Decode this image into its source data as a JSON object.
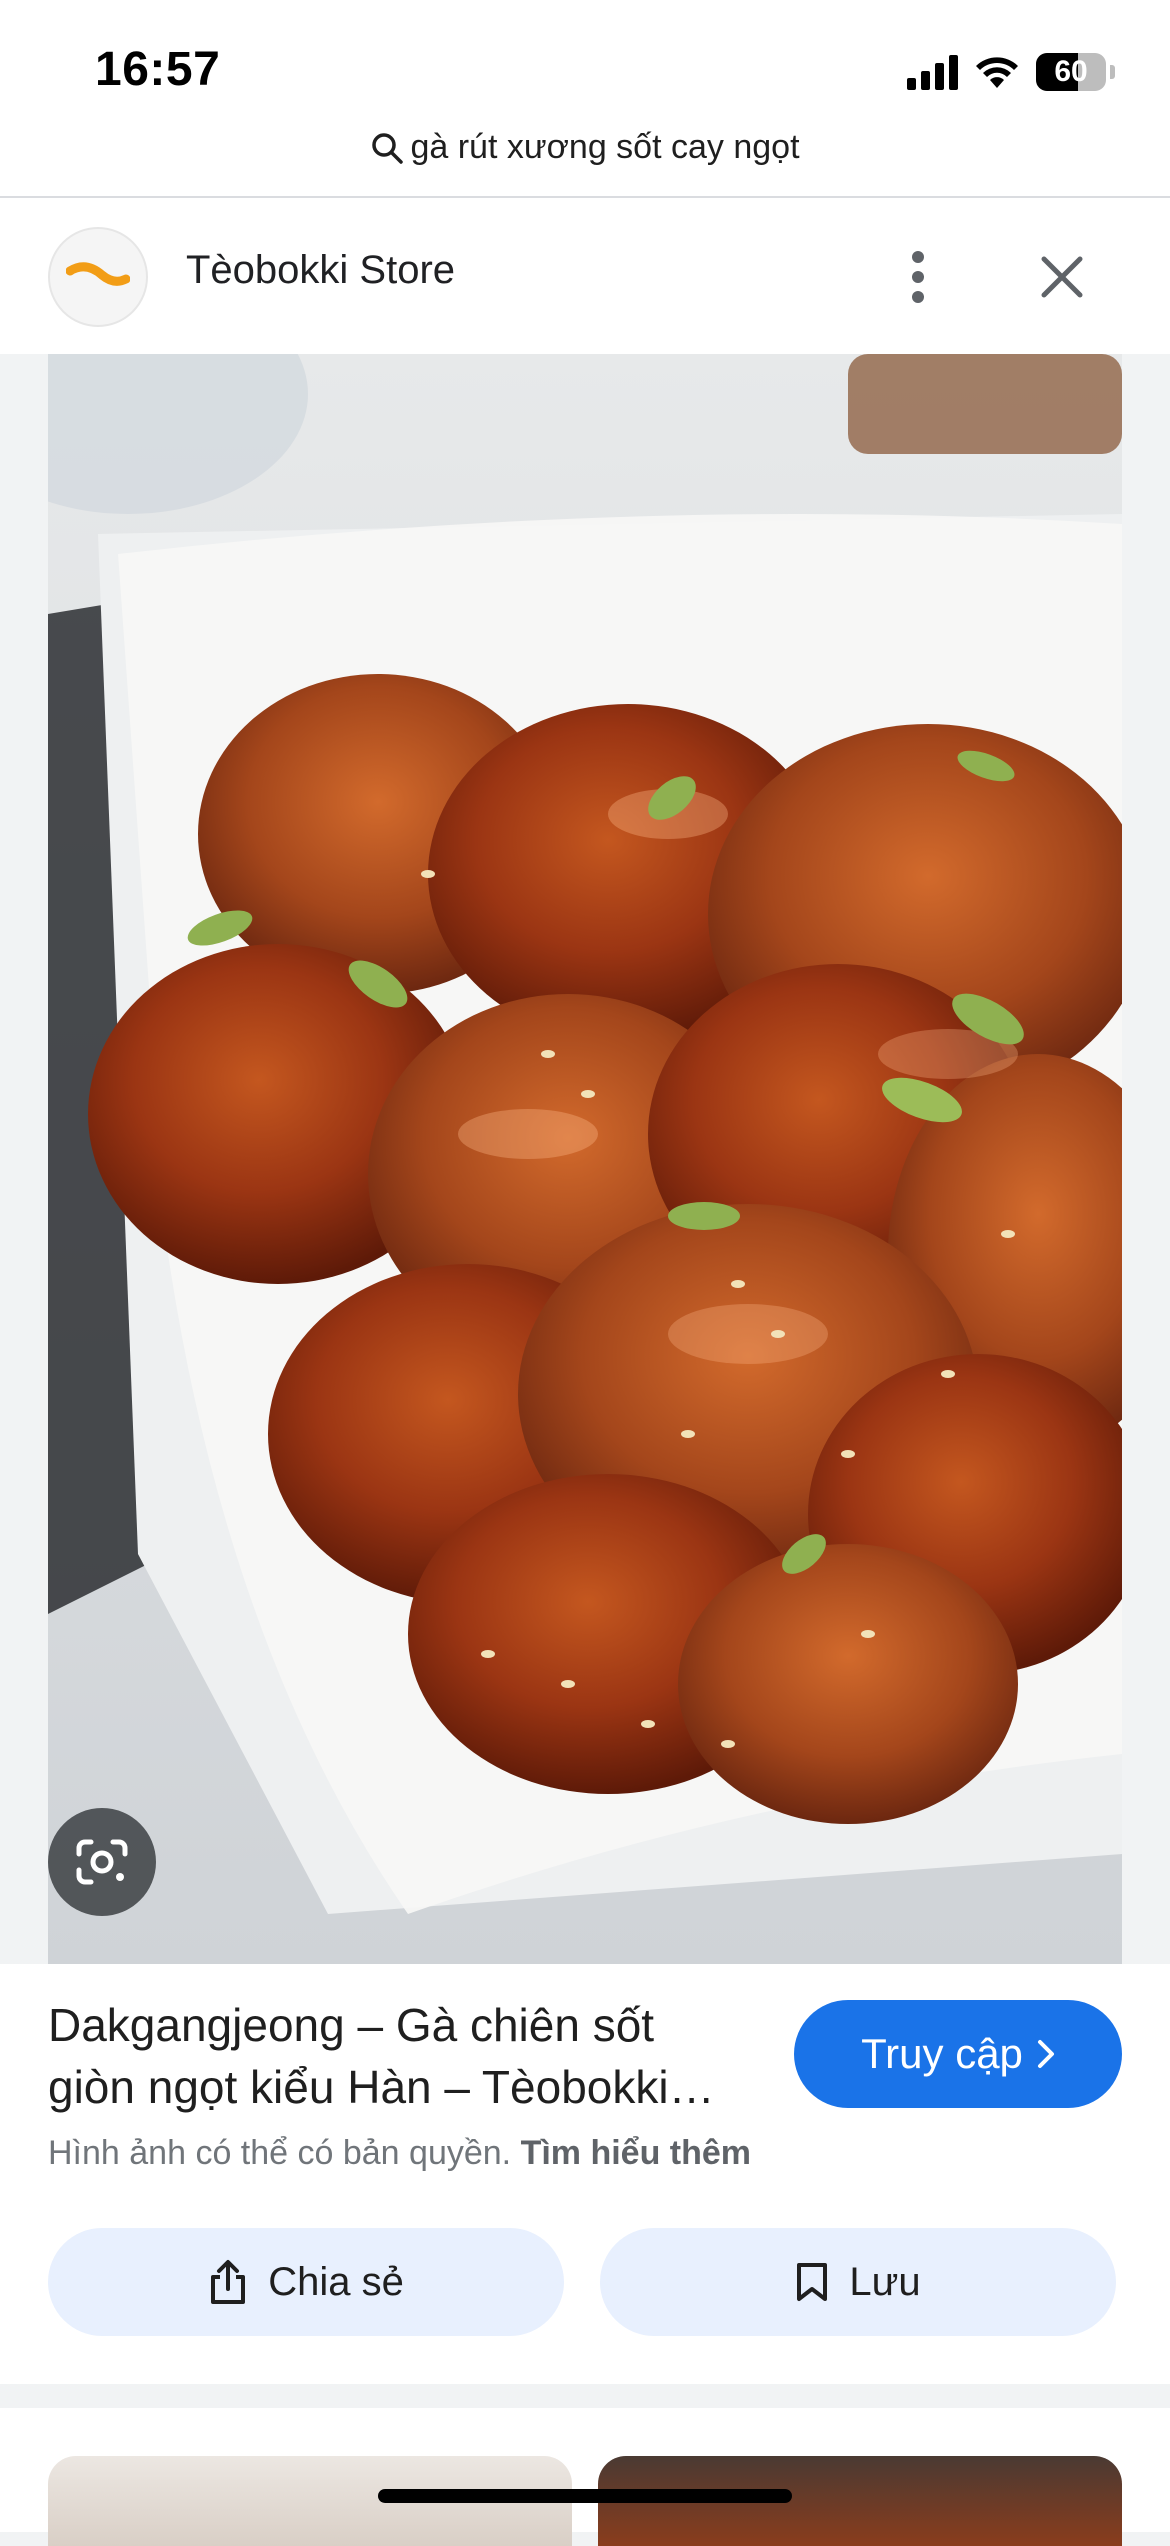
{
  "status_bar": {
    "time": "16:57",
    "battery": "60",
    "battery_level": 0.6
  },
  "search": {
    "icon": "search-icon",
    "query": "gà rút xương sốt cay ngọt"
  },
  "source": {
    "name": "Tèobokki Store",
    "avatar_icon": "store-logo",
    "more_icon": "more-vert-icon",
    "close_icon": "close-icon"
  },
  "image": {
    "subject": "food-photo",
    "lens_icon": "google-lens-icon"
  },
  "result": {
    "title": "Dakgangjeong – Gà chiên sốt giòn ngọt kiểu Hàn – Tèobokki Store",
    "visit_label": "Truy cập",
    "copyright_text": "Hình ảnh có thể có bản quyền.",
    "learn_more": "Tìm hiểu thêm",
    "share_label": "Chia sẻ",
    "save_label": "Lưu"
  },
  "colors": {
    "accent": "#1a73e8",
    "button_bg": "#e8f0fe",
    "page_bg": "#f1f3f4"
  }
}
